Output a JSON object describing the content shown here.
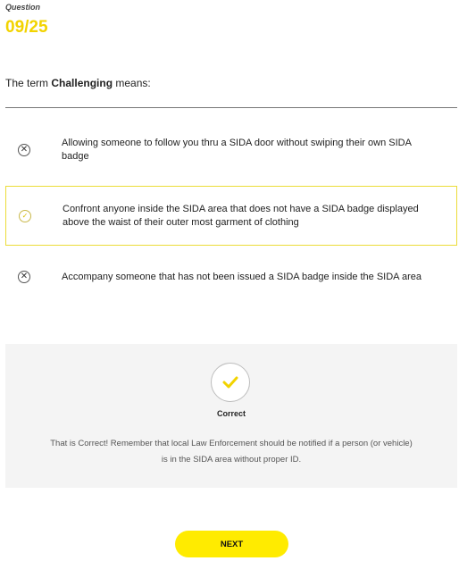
{
  "header": {
    "label": "Question",
    "number": "09/25"
  },
  "prompt": {
    "before": "The term ",
    "term": "Challenging",
    "after": " means:"
  },
  "options": [
    {
      "text": "Allowing someone to follow you thru a SIDA door without swiping their own SIDA badge",
      "icon": "x-circle-icon",
      "state": "incorrect"
    },
    {
      "text": "Confront anyone inside the SIDA area that does not have a SIDA badge displayed above the waist of their outer most garment of clothing",
      "icon": "check-circle-icon",
      "state": "selected"
    },
    {
      "text": "Accompany someone that has not been issued a SIDA badge inside the SIDA area",
      "icon": "x-circle-icon",
      "state": "incorrect"
    }
  ],
  "feedback": {
    "title": "Correct",
    "message": "That is Correct! Remember that local Law Enforcement should be notified if a person (or vehicle) is in the SIDA area without proper ID.",
    "icon": "checkmark-icon"
  },
  "next_label": "NEXT",
  "colors": {
    "accent": "#ffeb00",
    "number": "#f2d300",
    "selected_border": "#ecdc38",
    "feedback_bg": "#f4f4f4"
  }
}
